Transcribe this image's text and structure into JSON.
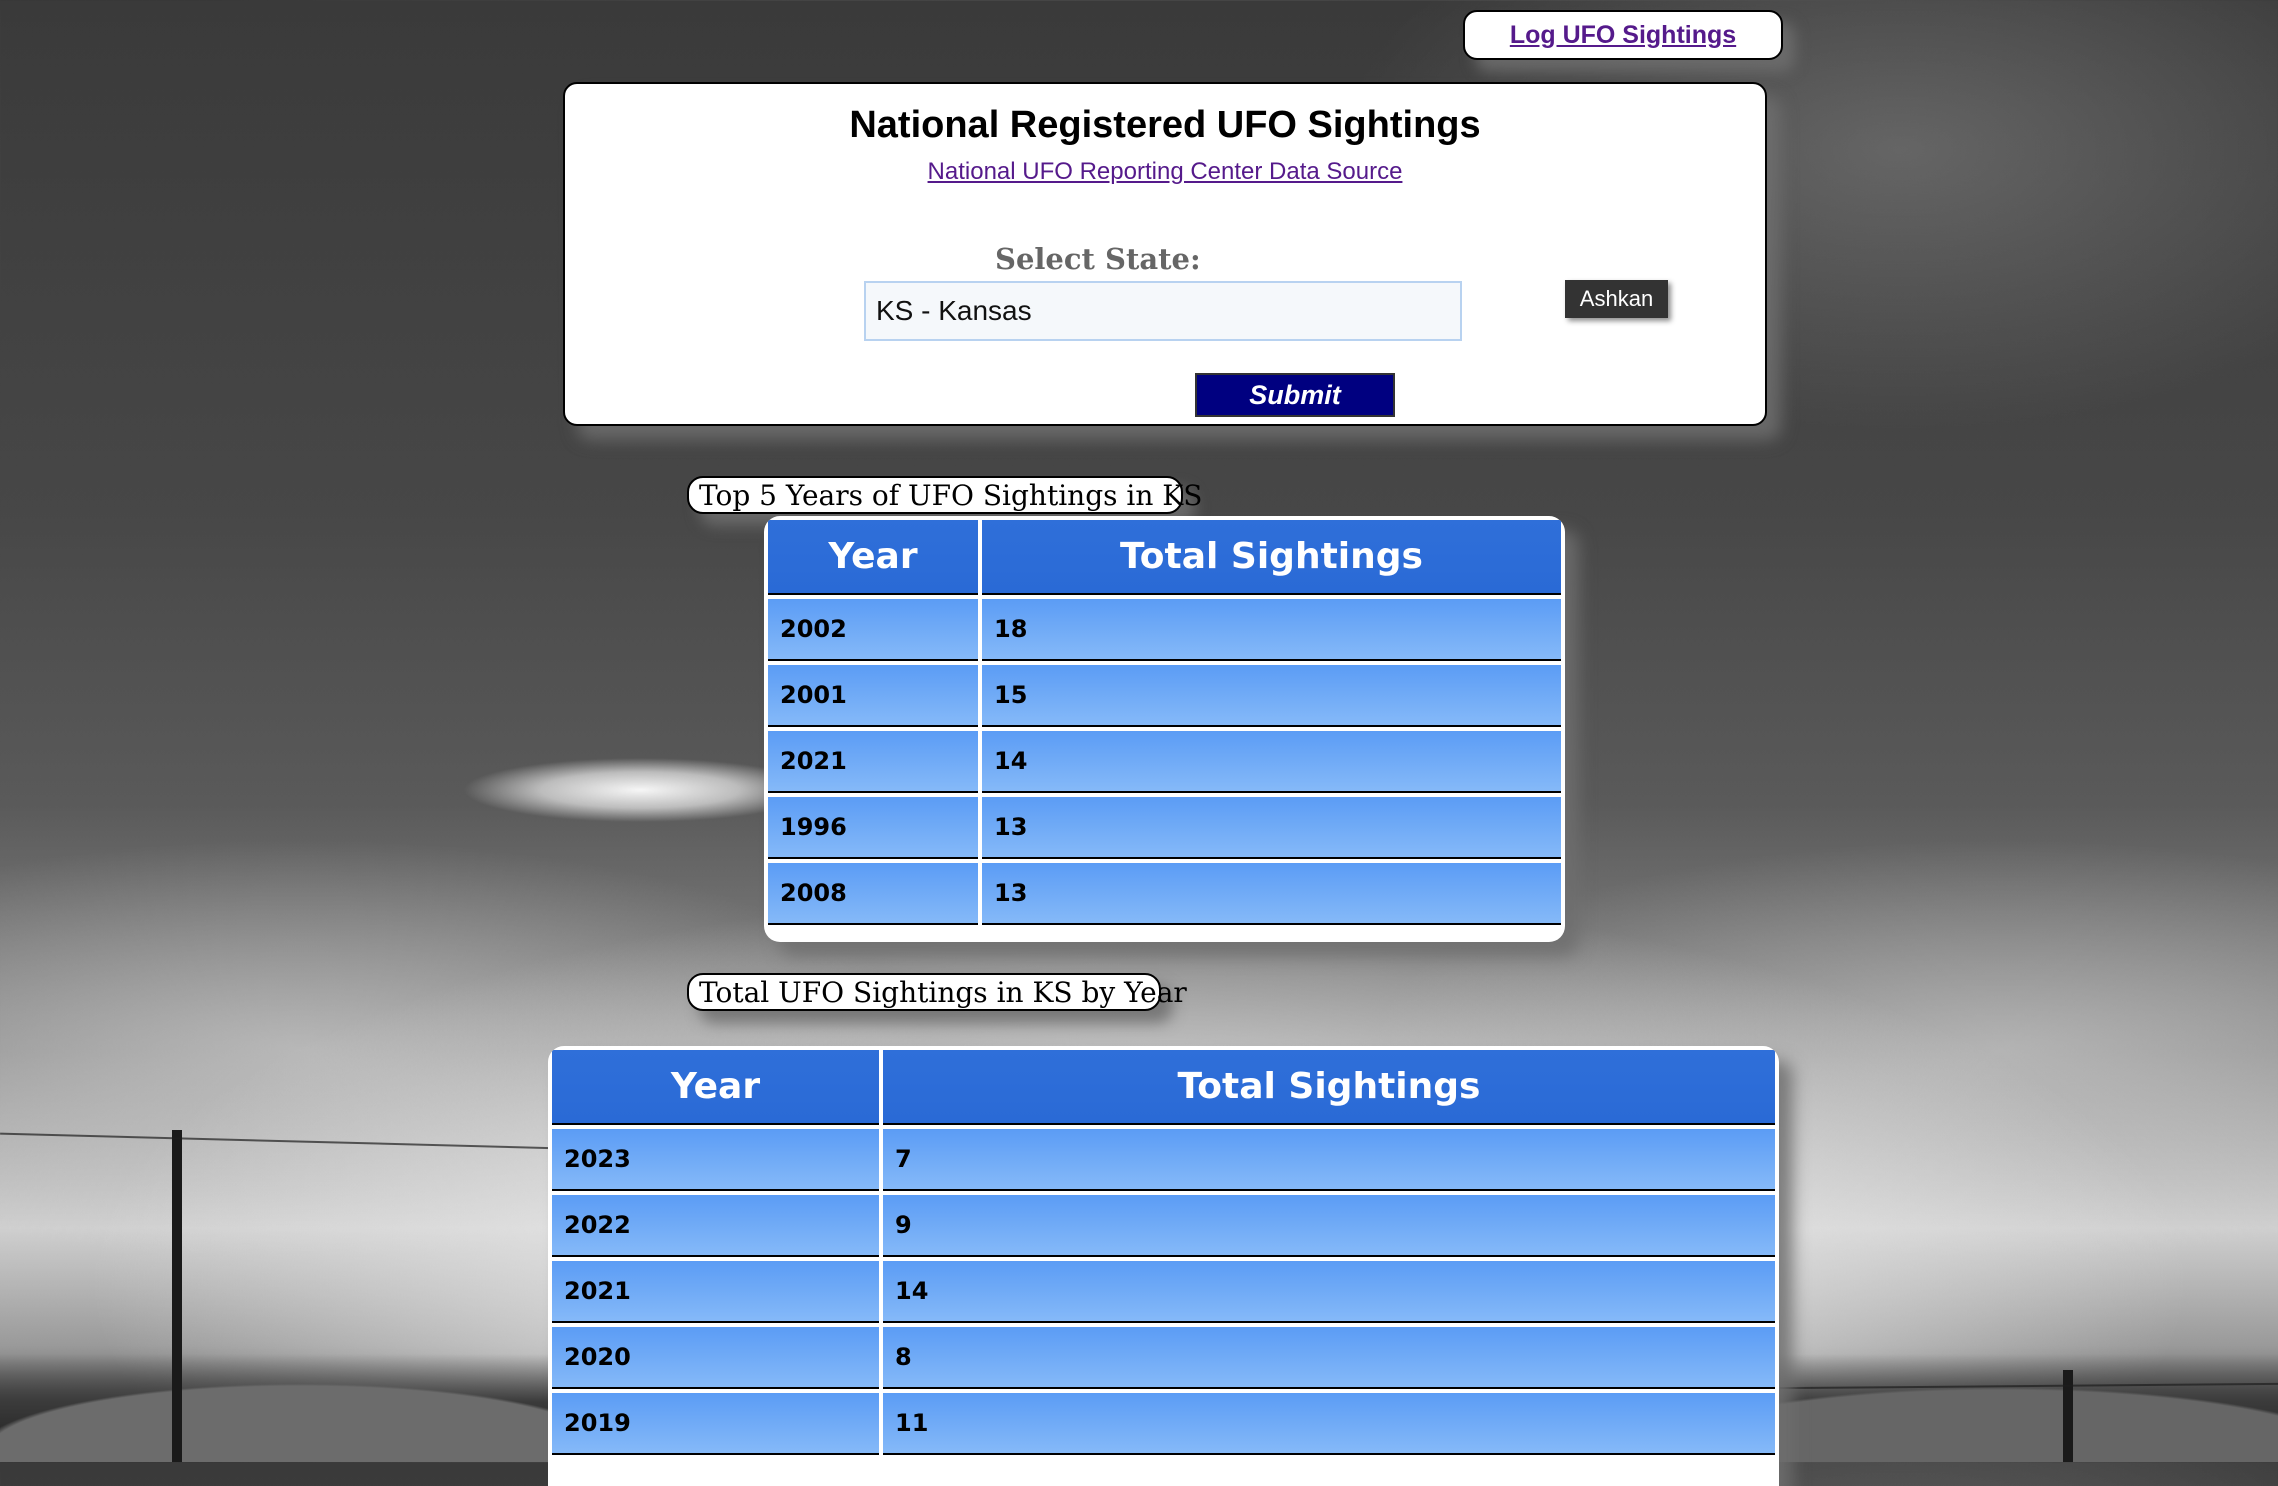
{
  "header": {
    "log_link": "Log UFO Sightings",
    "title": "National Registered UFO Sightings",
    "source_link": "National UFO Reporting Center Data Source",
    "select_label": "Select State:",
    "selected_state": "KS - Kansas",
    "user_name": "Ashkan",
    "submit_label": "Submit"
  },
  "top5": {
    "label": "Top 5 Years of UFO Sightings in KS",
    "columns": [
      "Year",
      "Total Sightings"
    ],
    "rows": [
      [
        "2002",
        "18"
      ],
      [
        "2001",
        "15"
      ],
      [
        "2021",
        "14"
      ],
      [
        "1996",
        "13"
      ],
      [
        "2008",
        "13"
      ]
    ]
  },
  "by_year": {
    "label": "Total UFO Sightings in KS by Year",
    "columns": [
      "Year",
      "Total Sightings"
    ],
    "rows": [
      [
        "2023",
        "7"
      ],
      [
        "2022",
        "9"
      ],
      [
        "2021",
        "14"
      ],
      [
        "2020",
        "8"
      ],
      [
        "2019",
        "11"
      ]
    ]
  },
  "colors": {
    "header_cell": "#2f6fd9",
    "data_cell": "#6ea9f6",
    "submit_bg": "#000080",
    "link": "#551a8b"
  }
}
